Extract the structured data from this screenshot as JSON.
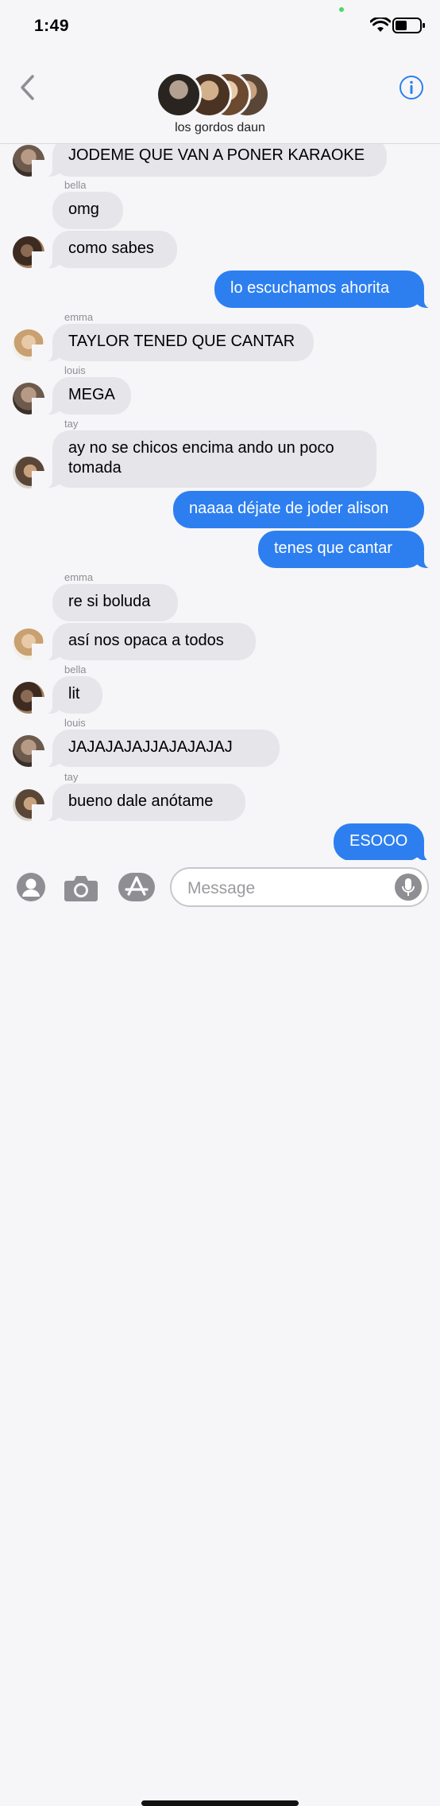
{
  "status_bar": {
    "time": "1:49",
    "wifi_icon": "wifi-icon",
    "battery_icon": "battery-icon"
  },
  "header": {
    "back_icon": "chevron-left-icon",
    "info_icon": "info-icon",
    "group_name": "los gordos daun"
  },
  "messages": [
    {
      "sender": "",
      "text": "JODEME QUE VAN A PONER KARAOKE",
      "direction": "in"
    },
    {
      "sender": "bella",
      "text": "omg",
      "direction": "in"
    },
    {
      "sender": "",
      "text": "como sabes",
      "direction": "in"
    },
    {
      "sender": "",
      "text": "lo escuchamos ahorita",
      "direction": "out"
    },
    {
      "sender": "emma",
      "text": "TAYLOR TENED QUE CANTAR",
      "direction": "in"
    },
    {
      "sender": "louis",
      "text": "MEGA",
      "direction": "in"
    },
    {
      "sender": "tay",
      "text": "ay no se chicos encima ando un poco tomada",
      "direction": "in"
    },
    {
      "sender": "",
      "text": "naaaa déjate de joder alison",
      "direction": "out"
    },
    {
      "sender": "",
      "text": "tenes que cantar",
      "direction": "out"
    },
    {
      "sender": "emma",
      "text": "re si boluda",
      "direction": "in"
    },
    {
      "sender": "",
      "text": "así nos opaca a todos",
      "direction": "in"
    },
    {
      "sender": "bella",
      "text": "lit",
      "direction": "in"
    },
    {
      "sender": "louis",
      "text": "JAJAJAJAJJAJAJAJAJ",
      "direction": "in"
    },
    {
      "sender": "tay",
      "text": "bueno dale anótame",
      "direction": "in"
    },
    {
      "sender": "",
      "text": "ESOOO",
      "direction": "out"
    }
  ],
  "input_bar": {
    "placeholder": "Message",
    "icons": [
      "memoji-icon",
      "camera-icon",
      "app-store-icon",
      "microphone-icon"
    ]
  },
  "colors": {
    "outgoing_bubble": "#2d7ff0",
    "incoming_bubble": "#e5e5ea",
    "accent": "#2d7ff0"
  }
}
